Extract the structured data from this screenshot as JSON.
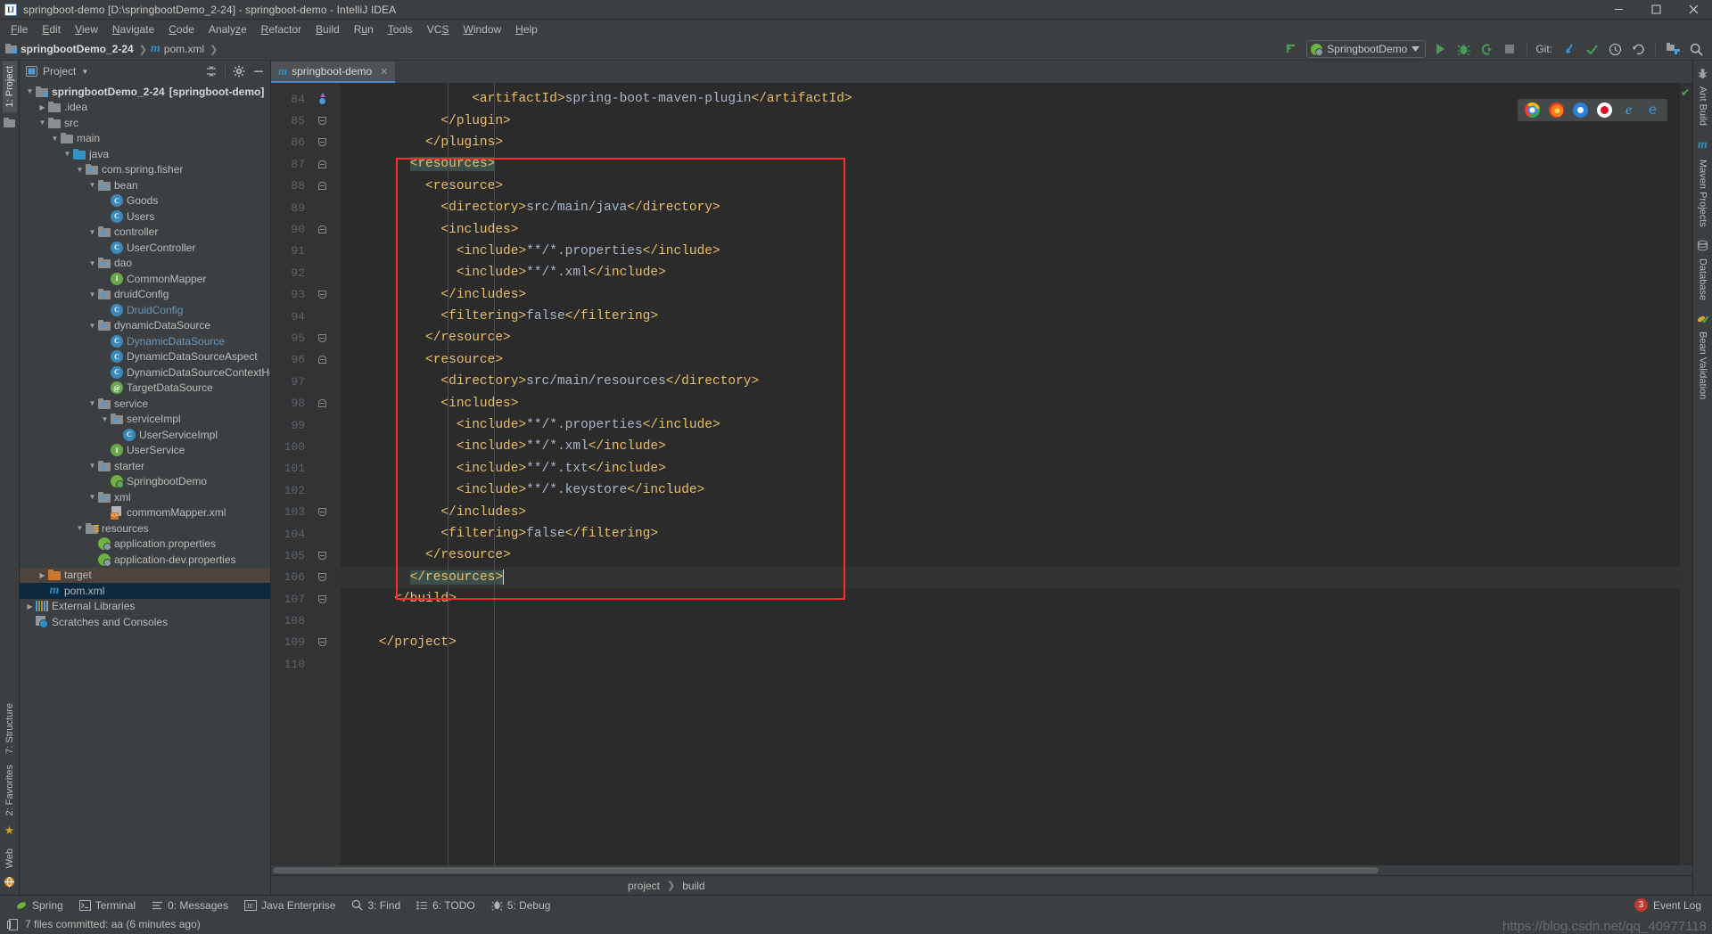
{
  "window": {
    "title": "springboot-demo [D:\\springbootDemo_2-24] - springboot-demo - IntelliJ IDEA",
    "app_icon": "IJ",
    "minimize": "minimize-icon",
    "maximize": "maximize-icon",
    "close": "close-icon"
  },
  "menubar": [
    {
      "label": "File",
      "mnemonic": "F"
    },
    {
      "label": "Edit",
      "mnemonic": "E"
    },
    {
      "label": "View",
      "mnemonic": "V"
    },
    {
      "label": "Navigate",
      "mnemonic": "N"
    },
    {
      "label": "Code",
      "mnemonic": "C"
    },
    {
      "label": "Analyze",
      "mnemonic": "z"
    },
    {
      "label": "Refactor",
      "mnemonic": "R"
    },
    {
      "label": "Build",
      "mnemonic": "B"
    },
    {
      "label": "Run",
      "mnemonic": "u"
    },
    {
      "label": "Tools",
      "mnemonic": "T"
    },
    {
      "label": "VCS",
      "mnemonic": "S"
    },
    {
      "label": "Window",
      "mnemonic": "W"
    },
    {
      "label": "Help",
      "mnemonic": "H"
    }
  ],
  "navbar": {
    "crumbs": [
      "springbootDemo_2-24",
      "pom.xml"
    ],
    "run_config": "SpringbootDemo",
    "git_label": "Git:",
    "buttons": [
      "run-button",
      "debug-button",
      "run-with-coverage-button",
      "stop-button",
      "update-project-button",
      "commit-button",
      "history-button",
      "rollback-button",
      "project-structure-button",
      "search-everywhere-button"
    ]
  },
  "left_tool_tabs": [
    {
      "label": "1: Project",
      "mnemonic": "1",
      "active": true
    },
    {
      "label": "7: Structure",
      "mnemonic": "7"
    },
    {
      "label": "2: Favorites",
      "mnemonic": "2"
    },
    {
      "label": "Web"
    }
  ],
  "right_tool_tabs": [
    {
      "label": "Ant Build",
      "icon": "ant-icon"
    },
    {
      "label": "Maven Projects",
      "icon": "maven-icon"
    },
    {
      "label": "Database",
      "icon": "database-icon"
    },
    {
      "label": "Bean Validation",
      "icon": "bean-validation-icon"
    }
  ],
  "project_panel": {
    "title": "Project",
    "header_icons": [
      "collapse-all-icon",
      "settings-gear-icon",
      "hide-panel-icon"
    ],
    "tree": [
      {
        "label": "springbootDemo_2-24",
        "bold_suffix": "[springboot-demo]",
        "path": "D:\\spring",
        "depth": 0,
        "arrow": "down",
        "icon": "module-folder",
        "type": "module"
      },
      {
        "label": ".idea",
        "depth": 1,
        "arrow": "right",
        "icon": "folder",
        "type": "folder"
      },
      {
        "label": "src",
        "depth": 1,
        "arrow": "down",
        "icon": "folder",
        "type": "folder"
      },
      {
        "label": "main",
        "depth": 2,
        "arrow": "down",
        "icon": "folder",
        "type": "folder"
      },
      {
        "label": "java",
        "depth": 3,
        "arrow": "down",
        "icon": "source-folder",
        "type": "source"
      },
      {
        "label": "com.spring.fisher",
        "depth": 4,
        "arrow": "down",
        "icon": "package",
        "type": "package"
      },
      {
        "label": "bean",
        "depth": 5,
        "arrow": "down",
        "icon": "package",
        "type": "package"
      },
      {
        "label": "Goods",
        "depth": 6,
        "arrow": "none",
        "icon": "class-icon",
        "type": "class"
      },
      {
        "label": "Users",
        "depth": 6,
        "arrow": "none",
        "icon": "class-icon",
        "type": "class"
      },
      {
        "label": "controller",
        "depth": 5,
        "arrow": "down",
        "icon": "package",
        "type": "package"
      },
      {
        "label": "UserController",
        "depth": 6,
        "arrow": "none",
        "icon": "class-icon",
        "type": "class"
      },
      {
        "label": "dao",
        "depth": 5,
        "arrow": "down",
        "icon": "package",
        "type": "package"
      },
      {
        "label": "CommonMapper",
        "depth": 6,
        "arrow": "none",
        "icon": "interface-icon",
        "type": "interface"
      },
      {
        "label": "druidConfig",
        "depth": 5,
        "arrow": "down",
        "icon": "package",
        "type": "package"
      },
      {
        "label": "DruidConfig",
        "depth": 6,
        "arrow": "none",
        "icon": "class-icon",
        "type": "class",
        "color": "blue"
      },
      {
        "label": "dynamicDataSource",
        "depth": 5,
        "arrow": "down",
        "icon": "package",
        "type": "package"
      },
      {
        "label": "DynamicDataSource",
        "depth": 6,
        "arrow": "none",
        "icon": "class-icon",
        "type": "class",
        "color": "blue"
      },
      {
        "label": "DynamicDataSourceAspect",
        "depth": 6,
        "arrow": "none",
        "icon": "class-icon",
        "type": "class"
      },
      {
        "label": "DynamicDataSourceContextHolder",
        "depth": 6,
        "arrow": "none",
        "icon": "class-icon",
        "type": "class"
      },
      {
        "label": "TargetDataSource",
        "depth": 6,
        "arrow": "none",
        "icon": "annotation-icon",
        "type": "annotation"
      },
      {
        "label": "service",
        "depth": 5,
        "arrow": "down",
        "icon": "package",
        "type": "package"
      },
      {
        "label": "serviceImpl",
        "depth": 6,
        "arrow": "down",
        "icon": "package",
        "type": "package"
      },
      {
        "label": "UserServiceImpl",
        "depth": 7,
        "arrow": "none",
        "icon": "class-icon",
        "type": "class"
      },
      {
        "label": "UserService",
        "depth": 6,
        "arrow": "none",
        "icon": "interface-icon",
        "type": "interface"
      },
      {
        "label": "starter",
        "depth": 5,
        "arrow": "down",
        "icon": "package",
        "type": "package"
      },
      {
        "label": "SpringbootDemo",
        "depth": 6,
        "arrow": "none",
        "icon": "spring-boot-icon",
        "type": "springboot"
      },
      {
        "label": "xml",
        "depth": 5,
        "arrow": "down",
        "icon": "package",
        "type": "package"
      },
      {
        "label": "commomMapper.xml",
        "depth": 6,
        "arrow": "none",
        "icon": "xml-file-icon",
        "type": "xml"
      },
      {
        "label": "resources",
        "depth": 4,
        "arrow": "down",
        "icon": "resources-folder",
        "type": "resources"
      },
      {
        "label": "application.properties",
        "depth": 5,
        "arrow": "none",
        "icon": "spring-properties-icon",
        "type": "springprop"
      },
      {
        "label": "application-dev.properties",
        "depth": 5,
        "arrow": "none",
        "icon": "spring-properties-icon",
        "type": "springprop"
      },
      {
        "label": "target",
        "depth": 1,
        "arrow": "right",
        "icon": "excluded-folder",
        "type": "excluded",
        "highlight": "secondary"
      },
      {
        "label": "pom.xml",
        "depth": 1,
        "arrow": "none",
        "icon": "maven-file-icon",
        "type": "maven",
        "highlight": "selected"
      },
      {
        "label": "External Libraries",
        "depth": 0,
        "arrow": "right",
        "icon": "libraries-icon",
        "type": "libraries"
      },
      {
        "label": "Scratches and Consoles",
        "depth": 0,
        "arrow": "none",
        "icon": "scratches-icon",
        "type": "scratches"
      }
    ]
  },
  "editor": {
    "tab": {
      "label": "springboot-demo",
      "icon": "maven-file-icon",
      "close": "close-tab-icon"
    },
    "first_line_number": 84,
    "cursor_line": 106,
    "lines": [
      {
        "n": 84,
        "indent": 8,
        "fold": "none",
        "bookmark": true,
        "segments": [
          {
            "t": "tag",
            "v": "<artifactId>"
          },
          {
            "t": "txt",
            "v": "spring-boot-maven-plugin"
          },
          {
            "t": "tag",
            "v": "</artifactId>"
          }
        ]
      },
      {
        "n": 85,
        "indent": 6,
        "fold": "closed-end",
        "segments": [
          {
            "t": "tag",
            "v": "</plugin>"
          }
        ]
      },
      {
        "n": 86,
        "indent": 5,
        "fold": "closed-end",
        "segments": [
          {
            "t": "tag",
            "v": "</plugins>"
          }
        ]
      },
      {
        "n": 87,
        "indent": 4,
        "fold": "open",
        "segments": [
          {
            "t": "tag",
            "v": "<resources>",
            "hl": true
          }
        ]
      },
      {
        "n": 88,
        "indent": 5,
        "fold": "open",
        "segments": [
          {
            "t": "tag",
            "v": "<resource>"
          }
        ]
      },
      {
        "n": 89,
        "indent": 6,
        "fold": "none",
        "segments": [
          {
            "t": "tag",
            "v": "<directory>"
          },
          {
            "t": "txt",
            "v": "src/main/java"
          },
          {
            "t": "tag",
            "v": "</directory>"
          }
        ]
      },
      {
        "n": 90,
        "indent": 6,
        "fold": "open",
        "segments": [
          {
            "t": "tag",
            "v": "<includes>"
          }
        ]
      },
      {
        "n": 91,
        "indent": 7,
        "fold": "none",
        "segments": [
          {
            "t": "tag",
            "v": "<include>"
          },
          {
            "t": "txt",
            "v": "**/*.properties"
          },
          {
            "t": "tag",
            "v": "</include>"
          }
        ]
      },
      {
        "n": 92,
        "indent": 7,
        "fold": "none",
        "segments": [
          {
            "t": "tag",
            "v": "<include>"
          },
          {
            "t": "txt",
            "v": "**/*.xml"
          },
          {
            "t": "tag",
            "v": "</include>"
          }
        ]
      },
      {
        "n": 93,
        "indent": 6,
        "fold": "closed-end",
        "segments": [
          {
            "t": "tag",
            "v": "</includes>"
          }
        ]
      },
      {
        "n": 94,
        "indent": 6,
        "fold": "none",
        "segments": [
          {
            "t": "tag",
            "v": "<filtering>"
          },
          {
            "t": "txt",
            "v": "false"
          },
          {
            "t": "tag",
            "v": "</filtering>"
          }
        ]
      },
      {
        "n": 95,
        "indent": 5,
        "fold": "closed-end",
        "segments": [
          {
            "t": "tag",
            "v": "</resource>"
          }
        ]
      },
      {
        "n": 96,
        "indent": 5,
        "fold": "open",
        "segments": [
          {
            "t": "tag",
            "v": "<resource>"
          }
        ]
      },
      {
        "n": 97,
        "indent": 6,
        "fold": "none",
        "segments": [
          {
            "t": "tag",
            "v": "<directory>"
          },
          {
            "t": "txt",
            "v": "src/main/resources"
          },
          {
            "t": "tag",
            "v": "</directory>"
          }
        ]
      },
      {
        "n": 98,
        "indent": 6,
        "fold": "open",
        "segments": [
          {
            "t": "tag",
            "v": "<includes>"
          }
        ]
      },
      {
        "n": 99,
        "indent": 7,
        "fold": "none",
        "segments": [
          {
            "t": "tag",
            "v": "<include>"
          },
          {
            "t": "txt",
            "v": "**/*.properties"
          },
          {
            "t": "tag",
            "v": "</include>"
          }
        ]
      },
      {
        "n": 100,
        "indent": 7,
        "fold": "none",
        "segments": [
          {
            "t": "tag",
            "v": "<include>"
          },
          {
            "t": "txt",
            "v": "**/*.xml"
          },
          {
            "t": "tag",
            "v": "</include>"
          }
        ]
      },
      {
        "n": 101,
        "indent": 7,
        "fold": "none",
        "segments": [
          {
            "t": "tag",
            "v": "<include>"
          },
          {
            "t": "txt",
            "v": "**/*.txt"
          },
          {
            "t": "tag",
            "v": "</include>"
          }
        ]
      },
      {
        "n": 102,
        "indent": 7,
        "fold": "none",
        "segments": [
          {
            "t": "tag",
            "v": "<include>"
          },
          {
            "t": "txt",
            "v": "**/*.keystore"
          },
          {
            "t": "tag",
            "v": "</include>"
          }
        ]
      },
      {
        "n": 103,
        "indent": 6,
        "fold": "closed-end",
        "segments": [
          {
            "t": "tag",
            "v": "</includes>"
          }
        ]
      },
      {
        "n": 104,
        "indent": 6,
        "fold": "none",
        "segments": [
          {
            "t": "tag",
            "v": "<filtering>"
          },
          {
            "t": "txt",
            "v": "false"
          },
          {
            "t": "tag",
            "v": "</filtering>"
          }
        ]
      },
      {
        "n": 105,
        "indent": 5,
        "fold": "closed-end",
        "segments": [
          {
            "t": "tag",
            "v": "</resource>"
          }
        ]
      },
      {
        "n": 106,
        "indent": 4,
        "fold": "closed-end",
        "segments": [
          {
            "t": "tag",
            "v": "</resources>",
            "hl": true
          }
        ]
      },
      {
        "n": 107,
        "indent": 3,
        "fold": "closed-end",
        "segments": [
          {
            "t": "tag",
            "v": "</build>"
          }
        ]
      },
      {
        "n": 108,
        "indent": 0,
        "fold": "none",
        "segments": []
      },
      {
        "n": 109,
        "indent": 2,
        "fold": "closed-end",
        "segments": [
          {
            "t": "tag",
            "v": "</project>"
          }
        ]
      },
      {
        "n": 110,
        "indent": 0,
        "fold": "none",
        "segments": []
      }
    ],
    "breadcrumb": [
      "project",
      "build"
    ],
    "browser_popup": [
      "chrome-icon",
      "firefox-icon",
      "safari-icon",
      "opera-icon",
      "ie-icon",
      "edge-icon"
    ],
    "inspection_status": "ok-checkmark"
  },
  "bottom_toolwindows": [
    {
      "label": "Spring",
      "icon": "spring-icon"
    },
    {
      "label": "Terminal",
      "icon": "terminal-icon"
    },
    {
      "label": "0: Messages",
      "mnemonic": "0",
      "icon": "messages-icon"
    },
    {
      "label": "Java Enterprise",
      "icon": "java-enterprise-icon"
    },
    {
      "label": "3: Find",
      "mnemonic": "3",
      "icon": "find-icon"
    },
    {
      "label": "6: TODO",
      "mnemonic": "6",
      "icon": "todo-icon"
    },
    {
      "label": "5: Debug",
      "mnemonic": "5",
      "icon": "debug-icon"
    }
  ],
  "event_log": {
    "label": "Event Log",
    "count": "3"
  },
  "statusbar": {
    "message": "7 files committed: aa (6 minutes ago)",
    "icon": "vcs-icon"
  },
  "watermark": "https://blog.csdn.net/qq_40977118",
  "colors": {
    "accent_blue": "#4a88c7",
    "tag_orange": "#e8bf6a",
    "text_gray": "#a9b7c6",
    "redbox": "#ff2a2a",
    "selection": "#0d293e",
    "highlight_green": "#3a4f4a"
  }
}
